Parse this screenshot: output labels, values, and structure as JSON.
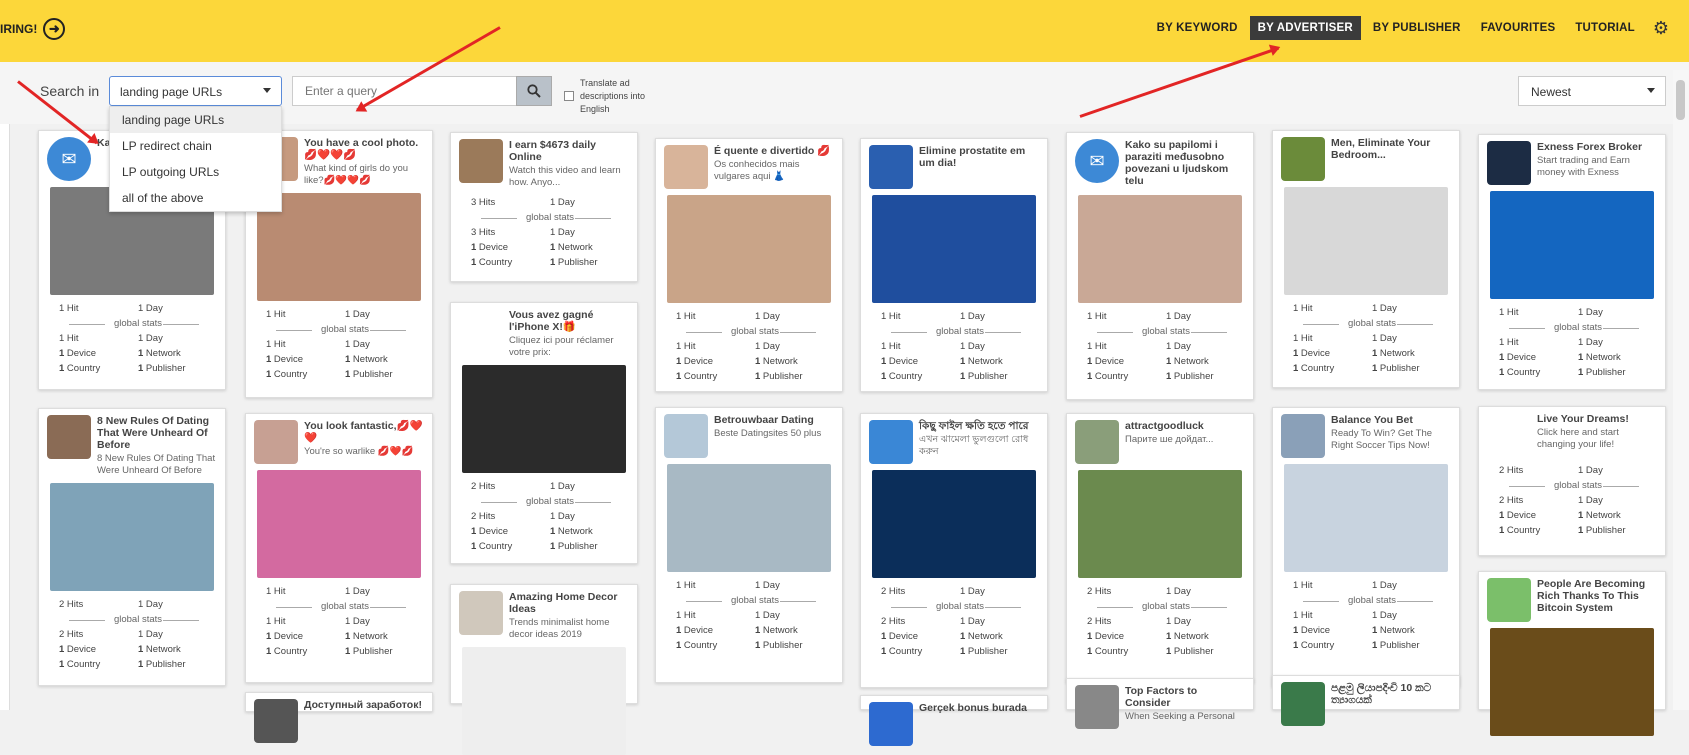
{
  "header": {
    "hiring_label": "IRING!",
    "nav": [
      "BY KEYWORD",
      "BY ADVERTISER",
      "BY PUBLISHER",
      "FAVOURITES",
      "TUTORIAL"
    ],
    "active_nav": "BY ADVERTISER"
  },
  "search": {
    "label": "Search in",
    "selected": "landing page URLs",
    "options": [
      "landing page URLs",
      "LP redirect chain",
      "LP outgoing URLs",
      "all of the above"
    ],
    "query_placeholder": "Enter a query",
    "translate_label": "Translate ad descriptions into English",
    "sort": "Newest"
  },
  "stats_labels": {
    "global": "global stats",
    "day": "Day",
    "device": "Device",
    "network": "Network",
    "country": "Country",
    "publisher": "Publisher"
  },
  "cards": [
    {
      "title": "Ka...",
      "desc": "",
      "hits": "1 Hit",
      "hits2": "1 Hit",
      "days": "1 Day",
      "icon": "mail",
      "thumb": "#3d89d6",
      "img": "#7a7a7a"
    },
    {
      "title": "You have a cool photo. 💋❤️❤️💋",
      "desc": "What kind of girls do you like?💋❤️❤️💋",
      "hits": "1 Hit",
      "hits2": "1 Hit",
      "days": "1 Day",
      "thumb": "#c69a7f",
      "img": "#b98b72"
    },
    {
      "title": "I earn $4673 daily Online",
      "desc": "Watch this video and learn how. Anyo...",
      "hits": "3 Hits",
      "hits2": "3 Hits",
      "days": "1 Day",
      "thumb": "#9b7a5a",
      "img": ""
    },
    {
      "title": "É quente e divertido 💋",
      "desc": "Os conhecidos mais vulgares aqui 👗",
      "hits": "1 Hit",
      "hits2": "1 Hit",
      "days": "1 Day",
      "thumb": "#d8b49a",
      "img": "#c9a488"
    },
    {
      "title": "Elimine prostatite em um dia!",
      "desc": "",
      "hits": "1 Hit",
      "hits2": "1 Hit",
      "days": "1 Day",
      "thumb": "#2a5fb0",
      "img": "#1f4e9e"
    },
    {
      "title": "Kako su papilomi i paraziti međusobno povezani u ljudskom telu",
      "desc": "",
      "hits": "1 Hit",
      "hits2": "1 Hit",
      "days": "1 Day",
      "icon": "mail",
      "thumb": "#3d89d6",
      "img": "#c9a896"
    },
    {
      "title": "Men, Eliminate Your Bedroom...",
      "desc": "",
      "hits": "1 Hit",
      "hits2": "1 Hit",
      "days": "1 Day",
      "thumb": "#6b8b3a",
      "img": "#d8d8d8"
    },
    {
      "title": "Exness Forex Broker",
      "desc": "Start trading and Earn money with Exness",
      "hits": "1 Hit",
      "hits2": "1 Hit",
      "days": "1 Day",
      "thumb": "#1c2c44",
      "img": "#1466c0"
    },
    {
      "title": "8 New Rules Of Dating That Were Unheard Of Before",
      "desc": "8 New Rules Of Dating That Were Unheard Of Before",
      "hits": "2 Hits",
      "hits2": "2 Hits",
      "days": "1 Day",
      "thumb": "#8a6b55",
      "img": "#7fa3b8"
    },
    {
      "title": "You look fantastic,💋❤️❤️",
      "desc": "You're so warlike 💋❤️💋",
      "hits": "1 Hit",
      "hits2": "1 Hit",
      "days": "1 Day",
      "thumb": "#c7a093",
      "img": "#d36aa0"
    },
    {
      "title": "Vous avez gagné l'iPhone X!🎁",
      "desc": "Cliquez ici pour réclamer votre prix:",
      "hits": "2 Hits",
      "hits2": "2 Hits",
      "days": "1 Day",
      "thumb": "#ffffff",
      "img": "#2b2b2b"
    },
    {
      "title": "Betrouwbaar Dating",
      "desc": "Beste Datingsites 50 plus",
      "hits": "1 Hit",
      "hits2": "1 Hit",
      "days": "1 Day",
      "thumb": "#b4c8d8",
      "img": "#a8b9c4"
    },
    {
      "title": "কিছু ফাইল ক্ষতি হতে পারে",
      "desc": "এখন ঝামেলা ভুলগুলো রোধ করুন",
      "hits": "2 Hits",
      "hits2": "2 Hits",
      "days": "1 Day",
      "thumb": "#3a87d6",
      "img": "#0b2e5a"
    },
    {
      "title": "attractgoodluck",
      "desc": "Парите ше дойдат...",
      "hits": "2 Hits",
      "hits2": "2 Hits",
      "days": "1 Day",
      "thumb": "#8a9e7a",
      "img": "#6b8a4e"
    },
    {
      "title": "Balance You Bet",
      "desc": "Ready To Win? Get The Right Soccer Tips Now!",
      "hits": "1 Hit",
      "hits2": "1 Hit",
      "days": "1 Day",
      "thumb": "#8aa0b8",
      "img": "#c8d3df"
    },
    {
      "title": "Live Your Dreams!",
      "desc": "Click here and start changing your life!",
      "hits": "2 Hits",
      "hits2": "2 Hits",
      "days": "1 Day",
      "thumb": "#ffffff",
      "img": ""
    },
    {
      "title": "Amazing Home Decor Ideas",
      "desc": "Trends minimalist home decor ideas 2019",
      "thumb": "#d0c8bc",
      "img": "#eeeeee"
    },
    {
      "title": "People Are Becoming Rich Thanks To This Bitcoin System",
      "desc": "",
      "thumb": "#7bbf6a",
      "img": "#6a4c1a"
    },
    {
      "title": "Доступный заработок!",
      "desc": "",
      "thumb": "#555",
      "img": ""
    },
    {
      "title": "Gerçek bonus burada",
      "desc": "",
      "thumb": "#2d6ad0",
      "img": ""
    },
    {
      "title": "Top Factors to Consider",
      "desc": "When Seeking a Personal",
      "thumb": "#888",
      "img": ""
    },
    {
      "title": "පළමු ලියාපදිංචි 10 කට ත්‍යාගයක්",
      "desc": "",
      "thumb": "#3a7a4a",
      "img": ""
    }
  ],
  "colors": {
    "topbar": "#fcd73a",
    "active_nav_bg": "#3b3b3b",
    "arrow": "#e22525"
  }
}
